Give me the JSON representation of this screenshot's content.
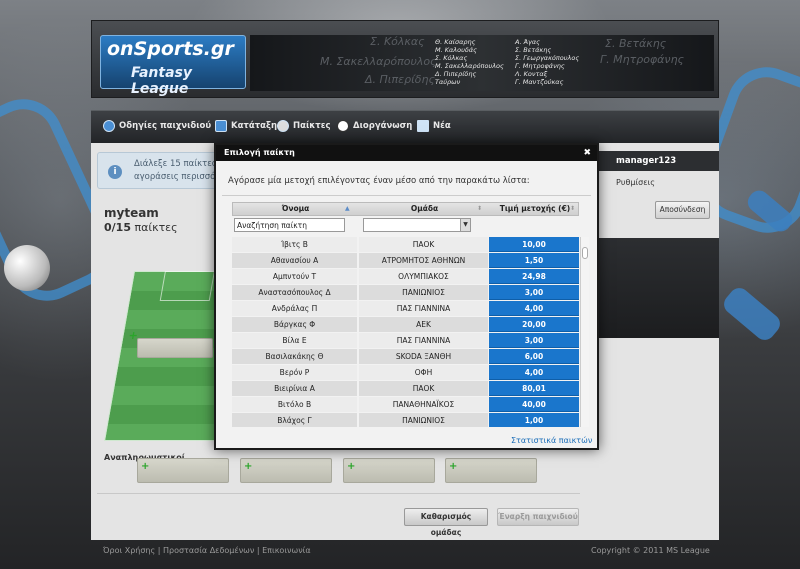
{
  "brand": {
    "logo_top": "onSports.gr",
    "logo_bottom": "Fantasy League"
  },
  "header_players": {
    "col1": [
      "Θ. Καίσαρης",
      "Μ. Καλουδάς",
      "Σ. Κόλκας",
      "Μ. Σακελλαρόπουλος",
      "Δ. Πιπερίδης",
      "Ταύρων"
    ],
    "col2": [
      "Α. Άγας",
      "Σ. Βετάκης",
      "Σ. Γεωργακόπουλος",
      "Γ. Μητροφάνης",
      "Λ. Κονταξ",
      "Γ. Μαντζούκας"
    ]
  },
  "nav": {
    "items": [
      {
        "label": "Οδηγίες παιχνιδιού",
        "icon": "help-icon"
      },
      {
        "label": "Κατάταξη",
        "icon": "ranking-icon"
      },
      {
        "label": "Παίκτες",
        "icon": "player-icon"
      },
      {
        "label": "Διοργάνωση",
        "icon": "ball-icon"
      },
      {
        "label": "Νέα",
        "icon": "news-icon"
      }
    ]
  },
  "info": {
    "line1": "Διάλεξε 15 παίκτες (",
    "line2": "αγοράσεις περισσότε"
  },
  "team": {
    "name": "myteam",
    "count": "0/15",
    "count_suffix": "παίκτες"
  },
  "subs_label": "Αναπληρωματικοί",
  "buttons": {
    "clear": "Καθαρισμός ομάδας",
    "start": "Έναρξη παιχνιδιού"
  },
  "user": {
    "name": "manager123",
    "settings": "Ρυθμίσεις",
    "logout": "Αποσύνδεση"
  },
  "footer": {
    "links": "Όροι Χρήσης  |  Προστασία Δεδομένων  |  Επικοινωνία",
    "copyright": "Copyright © 2011 MS League"
  },
  "modal": {
    "title": "Επιλογή παίκτη",
    "close": "✖",
    "instruction": "Αγόρασε μία μετοχή επιλέγοντας έναν μέσο από την παρακάτω λίστα:",
    "columns": [
      "Όνομα",
      "Ομάδα",
      "Τιμή μετοχής (€)"
    ],
    "search_value": "Αναζήτηση παίκτη",
    "team_filter": "",
    "stats_link": "Στατιστικά παικτών",
    "rows": [
      {
        "name": "Ίβιτς Β",
        "team": "ΠΑΟΚ",
        "price": "10,00"
      },
      {
        "name": "Αθανασίου Α",
        "team": "ΑΤΡΟΜΗΤΟΣ ΑΘΗΝΩΝ",
        "price": "1,50"
      },
      {
        "name": "Αμπντούν Τ",
        "team": "ΟΛΥΜΠΙΑΚΟΣ",
        "price": "24,98"
      },
      {
        "name": "Αναστασόπουλος Δ",
        "team": "ΠΑΝΙΩΝΙΟΣ",
        "price": "3,00"
      },
      {
        "name": "Ανδράλας Π",
        "team": "ΠΑΣ ΓΙΑΝΝΙΝΑ",
        "price": "4,00"
      },
      {
        "name": "Βάργκας Φ",
        "team": "ΑΕΚ",
        "price": "20,00"
      },
      {
        "name": "Βίλα Ε",
        "team": "ΠΑΣ ΓΙΑΝΝΙΝΑ",
        "price": "3,00"
      },
      {
        "name": "Βασιλακάκης Θ",
        "team": "SKODA ΞΑΝΘΗ",
        "price": "6,00"
      },
      {
        "name": "Βερόν Ρ",
        "team": "ΟΦΗ",
        "price": "4,00"
      },
      {
        "name": "Βιειρίνια Α",
        "team": "ΠΑΟΚ",
        "price": "80,01"
      },
      {
        "name": "Βιτόλο Β",
        "team": "ΠΑΝΑΘΗΝΑΪΚΟΣ",
        "price": "40,00"
      },
      {
        "name": "Βλάχος Γ",
        "team": "ΠΑΝΙΩΝΙΟΣ",
        "price": "1,00"
      }
    ]
  },
  "colors": {
    "price_bg": "#1a76cc",
    "accent": "#2c7cc4",
    "pitch": "#5aab5a"
  }
}
